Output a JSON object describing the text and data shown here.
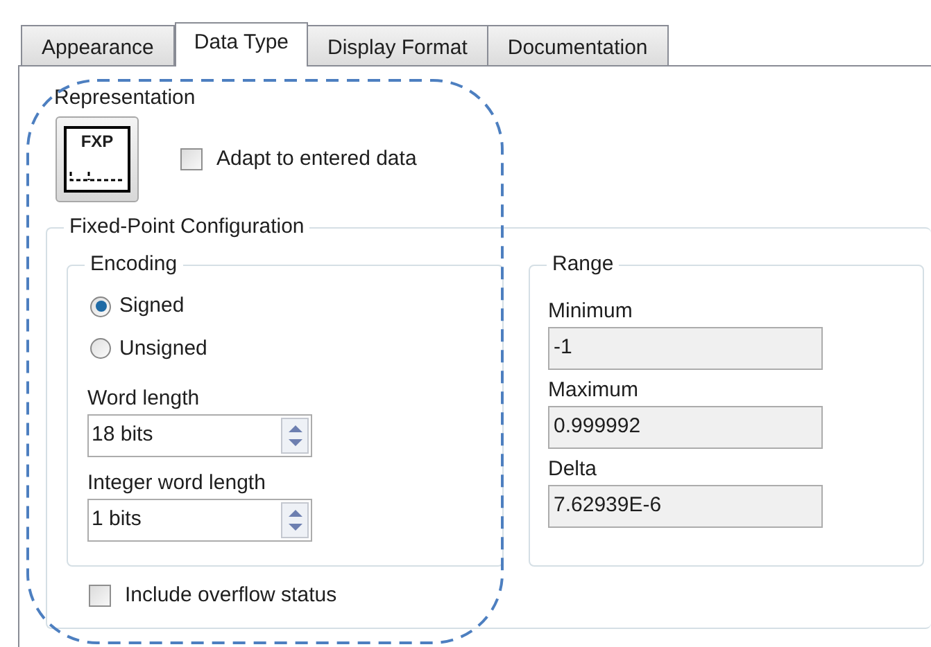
{
  "tabs": [
    {
      "label": "Appearance",
      "selected": false
    },
    {
      "label": "Data Type",
      "selected": true
    },
    {
      "label": "Display Format",
      "selected": false
    },
    {
      "label": "Documentation",
      "selected": false
    }
  ],
  "representation": {
    "label": "Representation",
    "icon_text": "FXP",
    "adapt": {
      "label": "Adapt to entered data",
      "checked": false
    }
  },
  "fixed_point": {
    "title": "Fixed-Point Configuration",
    "encoding": {
      "title": "Encoding",
      "options": [
        {
          "label": "Signed",
          "selected": true
        },
        {
          "label": "Unsigned",
          "selected": false
        }
      ],
      "fields": [
        {
          "label": "Word length",
          "value": "18 bits"
        },
        {
          "label": "Integer word length",
          "value": "1 bits"
        }
      ]
    },
    "range": {
      "title": "Range",
      "fields": [
        {
          "label": "Minimum",
          "value": "-1"
        },
        {
          "label": "Maximum",
          "value": "0.999992"
        },
        {
          "label": "Delta",
          "value": "7.62939E-6"
        }
      ]
    },
    "overflow": {
      "label": "Include overflow status",
      "checked": false
    }
  }
}
